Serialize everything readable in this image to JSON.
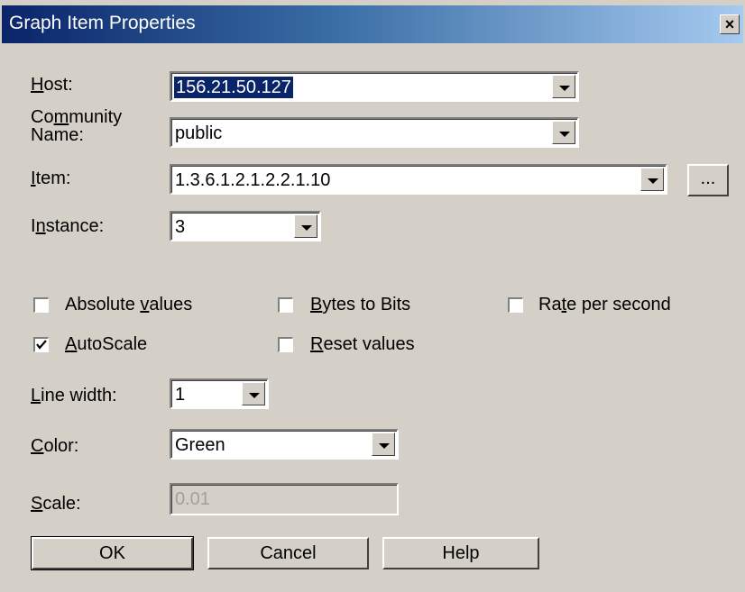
{
  "dialog": {
    "title": "Graph Item Properties",
    "close_glyph": "×"
  },
  "host": {
    "label_u": "H",
    "label_rest": "ost:",
    "value": "156.21.50.127"
  },
  "community": {
    "label_line1_pre": "Co",
    "label_line1_u": "m",
    "label_line1_post": "munity",
    "label_line2": "Name:",
    "value": "public"
  },
  "item": {
    "label_u": "I",
    "label_rest": "tem:",
    "value": "1.3.6.1.2.1.2.2.1.10",
    "browse_label": "..."
  },
  "instance": {
    "label_pre": "I",
    "label_u": "n",
    "label_post": "stance:",
    "value": "3"
  },
  "options": {
    "absolute_values": {
      "label_pre": "Absolute ",
      "label_u": "v",
      "label_post": "alues",
      "checked": false
    },
    "bytes_to_bits": {
      "label_pre": "",
      "label_u": "B",
      "label_post": "ytes to Bits",
      "checked": false
    },
    "rate_per_second": {
      "label_pre": "Ra",
      "label_u": "t",
      "label_post": "e per second",
      "checked": false
    },
    "autoscale": {
      "label_pre": "",
      "label_u": "A",
      "label_post": "utoScale",
      "checked": true
    },
    "reset_values": {
      "label_pre": "",
      "label_u": "R",
      "label_post": "eset values",
      "checked": false
    }
  },
  "line_width": {
    "label_u": "L",
    "label_rest": "ine width:",
    "value": "1"
  },
  "color": {
    "label_u": "C",
    "label_rest": "olor:",
    "value": "Green"
  },
  "scale": {
    "label_u": "S",
    "label_rest": "cale:",
    "value": "0.01"
  },
  "buttons": {
    "ok": "OK",
    "cancel": "Cancel",
    "help": "Help"
  }
}
